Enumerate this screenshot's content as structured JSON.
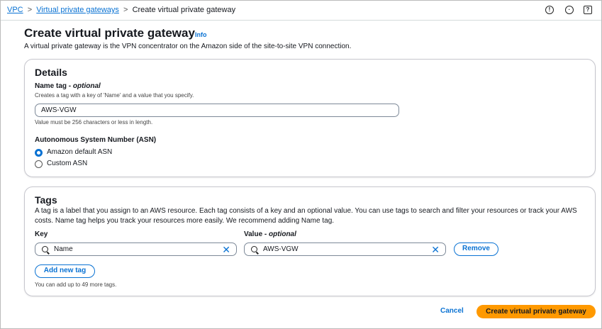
{
  "breadcrumb": {
    "items": [
      "VPC",
      "Virtual private gateways"
    ],
    "current": "Create virtual private gateway"
  },
  "header_icons": [
    "info-icon",
    "clock-icon",
    "feedback-icon"
  ],
  "page": {
    "title": "Create virtual private gateway",
    "info": "Info",
    "description": "A virtual private gateway is the VPN concentrator on the Amazon side of the site-to-site VPN connection."
  },
  "details": {
    "heading": "Details",
    "name_tag_label": "Name tag - ",
    "name_tag_optional": "optional",
    "name_tag_help": "Creates a tag with a key of 'Name' and a value that you specify.",
    "name_tag_value": "AWS-VGW",
    "name_tag_constraint": "Value must be 256 characters or less in length.",
    "asn_label": "Autonomous System Number (ASN)",
    "asn_options": [
      {
        "label": "Amazon default ASN",
        "selected": true
      },
      {
        "label": "Custom ASN",
        "selected": false
      }
    ]
  },
  "tags": {
    "heading": "Tags",
    "description": "A tag is a label that you assign to an AWS resource. Each tag consists of a key and an optional value. You can use tags to search and filter your resources or track your AWS costs. Name tag helps you track your resources more easily. We recommend adding Name tag.",
    "key_label": "Key",
    "value_label": "Value - ",
    "value_optional": "optional",
    "rows": [
      {
        "key": "Name",
        "value": "AWS-VGW"
      }
    ],
    "remove": "Remove",
    "add": "Add new tag",
    "hint": "You can add up to 49 more tags."
  },
  "footer": {
    "cancel": "Cancel",
    "submit": "Create virtual private gateway"
  },
  "colors": {
    "link": "#0972d3",
    "primary": "#ff9900"
  }
}
